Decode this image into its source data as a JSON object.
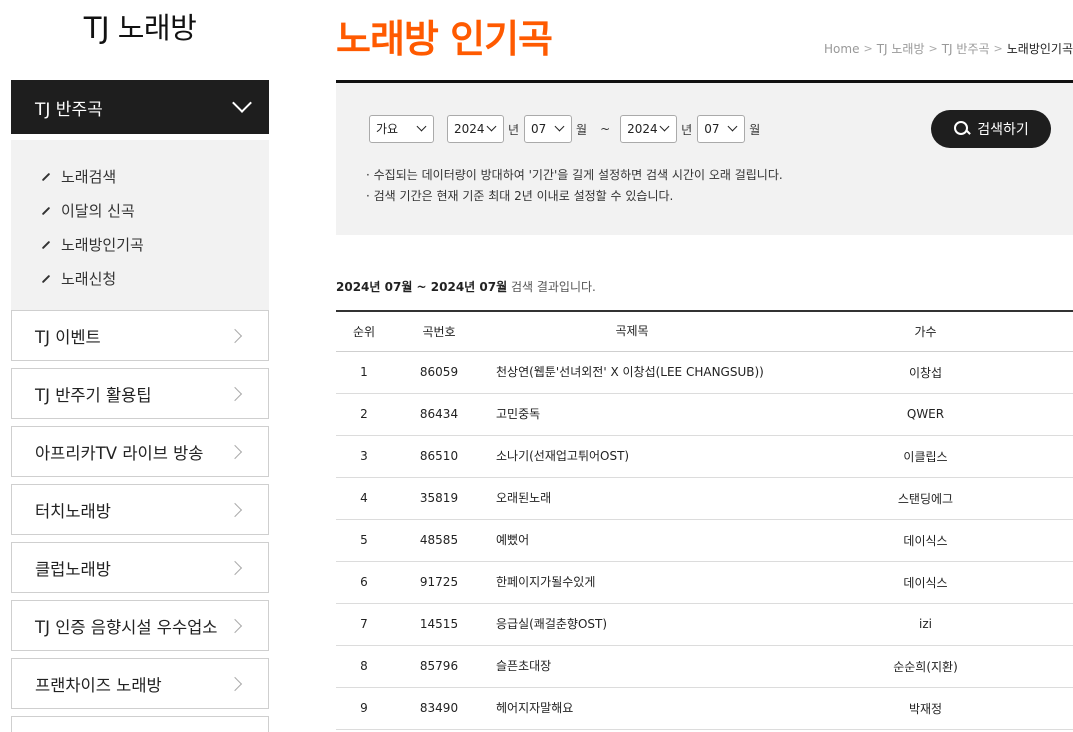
{
  "sidebar": {
    "site_title": "TJ 노래방",
    "active_menu": "TJ 반주곡",
    "submenu": [
      "노래검색",
      "이달의 신곡",
      "노래방인기곡",
      "노래신청"
    ],
    "menu_items": [
      "TJ 이벤트",
      "TJ 반주기 활용팁",
      "아프리카TV 라이브 방송",
      "터치노래방",
      "클럽노래방",
      "TJ 인증 음향시설 우수업소",
      "프랜차이즈 노래방"
    ]
  },
  "main": {
    "title": "노래방 인기곡",
    "breadcrumb": [
      "Home",
      "TJ 노래방",
      "TJ 반주곡",
      "노래방인기곡"
    ],
    "search": {
      "genre": "가요",
      "from_year": "2024",
      "year_unit": "년",
      "from_month": "07",
      "month_unit": "월",
      "tilde": "~",
      "to_year": "2024",
      "to_month": "07",
      "button_label": "검색하기",
      "notes": [
        "수집되는 데이터량이 방대하여 '기간'을 길게 설정하면 검색 시간이 오래 걸립니다.",
        "검색 기간은 현재 기준 최대 2년 이내로 설정할 수 있습니다."
      ]
    },
    "result": {
      "range_text": "2024년 07월 ~ 2024년 07월",
      "suffix": "검색 결과입니다."
    },
    "table": {
      "headers": [
        "순위",
        "곡번호",
        "곡제목",
        "가수"
      ],
      "rows": [
        {
          "rank": "1",
          "num": "86059",
          "title": "천상연(웹툰'선녀외전' X 이창섭(LEE CHANGSUB))",
          "artist": "이창섭"
        },
        {
          "rank": "2",
          "num": "86434",
          "title": "고민중독",
          "artist": "QWER"
        },
        {
          "rank": "3",
          "num": "86510",
          "title": "소나기(선재업고튀어OST)",
          "artist": "이클립스"
        },
        {
          "rank": "4",
          "num": "35819",
          "title": "오래된노래",
          "artist": "스탠딩에그"
        },
        {
          "rank": "5",
          "num": "48585",
          "title": "예뻤어",
          "artist": "데이식스"
        },
        {
          "rank": "6",
          "num": "91725",
          "title": "한페이지가될수있게",
          "artist": "데이식스"
        },
        {
          "rank": "7",
          "num": "14515",
          "title": "응급실(쾌걸춘향OST)",
          "artist": "izi"
        },
        {
          "rank": "8",
          "num": "85796",
          "title": "슬픈초대장",
          "artist": "순순희(지환)"
        },
        {
          "rank": "9",
          "num": "83490",
          "title": "헤어지자말해요",
          "artist": "박재정"
        }
      ]
    }
  }
}
